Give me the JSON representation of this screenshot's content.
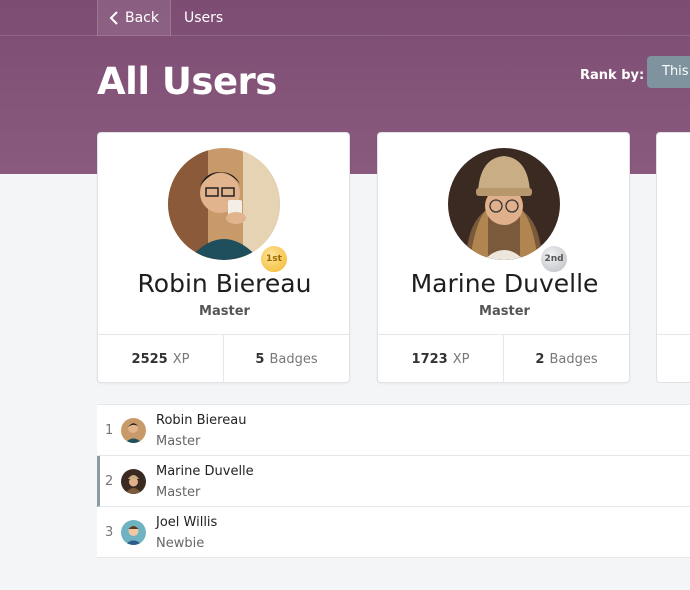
{
  "topbar": {
    "back_label": "Back",
    "breadcrumb": "Users"
  },
  "header": {
    "title": "All Users",
    "rank_by_label": "Rank by:",
    "rank_option": "This"
  },
  "podium": [
    {
      "name": "Robin Biereau",
      "rank": "Master",
      "medal": "1st",
      "xp": "2525",
      "xp_unit": "XP",
      "badges": "5",
      "badges_unit": "Badges"
    },
    {
      "name": "Marine Duvelle",
      "rank": "Master",
      "medal": "2nd",
      "xp": "1723",
      "xp_unit": "XP",
      "badges": "2",
      "badges_unit": "Badges"
    }
  ],
  "leaderboard": [
    {
      "position": "1",
      "name": "Robin Biereau",
      "rank": "Master"
    },
    {
      "position": "2",
      "name": "Marine Duvelle",
      "rank": "Master"
    },
    {
      "position": "3",
      "name": "Joel Willis",
      "rank": "Newbie"
    }
  ],
  "colors": {
    "header_bg": "#7d4c73",
    "gold_medal": "#f1b82b",
    "silver_medal": "#b9bcc1",
    "active_row_border": "#8c9aa4"
  }
}
